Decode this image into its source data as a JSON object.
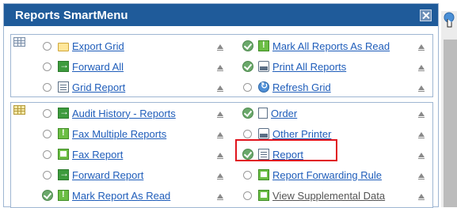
{
  "window": {
    "title": "Reports SmartMenu"
  },
  "section1": {
    "icon": "grid-icon",
    "left": [
      {
        "label": "Export Grid",
        "icon": "folder-icon",
        "selected": false
      },
      {
        "label": "Forward All",
        "icon": "forward-icon",
        "selected": false
      },
      {
        "label": "Grid Report",
        "icon": "report-icon",
        "selected": false
      }
    ],
    "right": [
      {
        "label": "Mark All Reports As Read",
        "icon": "mark-read-icon",
        "selected": true
      },
      {
        "label": "Print All Reports",
        "icon": "printer-icon",
        "selected": true
      },
      {
        "label": "Refresh Grid",
        "icon": "refresh-icon",
        "selected": false
      }
    ]
  },
  "section2": {
    "icon": "grid-icon",
    "left": [
      {
        "label": "Audit History - Reports",
        "icon": "forward-icon",
        "selected": false
      },
      {
        "label": "Fax Multiple Reports",
        "icon": "mark-read-icon",
        "selected": false
      },
      {
        "label": "Fax Report",
        "icon": "fax-icon",
        "selected": false
      },
      {
        "label": "Forward Report",
        "icon": "forward-icon",
        "selected": false
      },
      {
        "label": "Mark Report As Read",
        "icon": "mark-read-icon",
        "selected": true
      }
    ],
    "right": [
      {
        "label": "Order",
        "icon": "document-icon",
        "selected": true
      },
      {
        "label": "Other Printer",
        "icon": "printer-icon",
        "selected": false
      },
      {
        "label": "Report",
        "icon": "report-icon",
        "selected": true,
        "highlighted": true
      },
      {
        "label": "Report Forwarding Rule",
        "icon": "fax-icon",
        "selected": false
      },
      {
        "label": "View Supplemental Data",
        "icon": "fax-icon",
        "selected": false
      }
    ]
  },
  "colors": {
    "titlebar": "#1f5b9a",
    "link": "#1f5dba",
    "highlight": "#e0141d",
    "checked": "#6aa86a"
  }
}
